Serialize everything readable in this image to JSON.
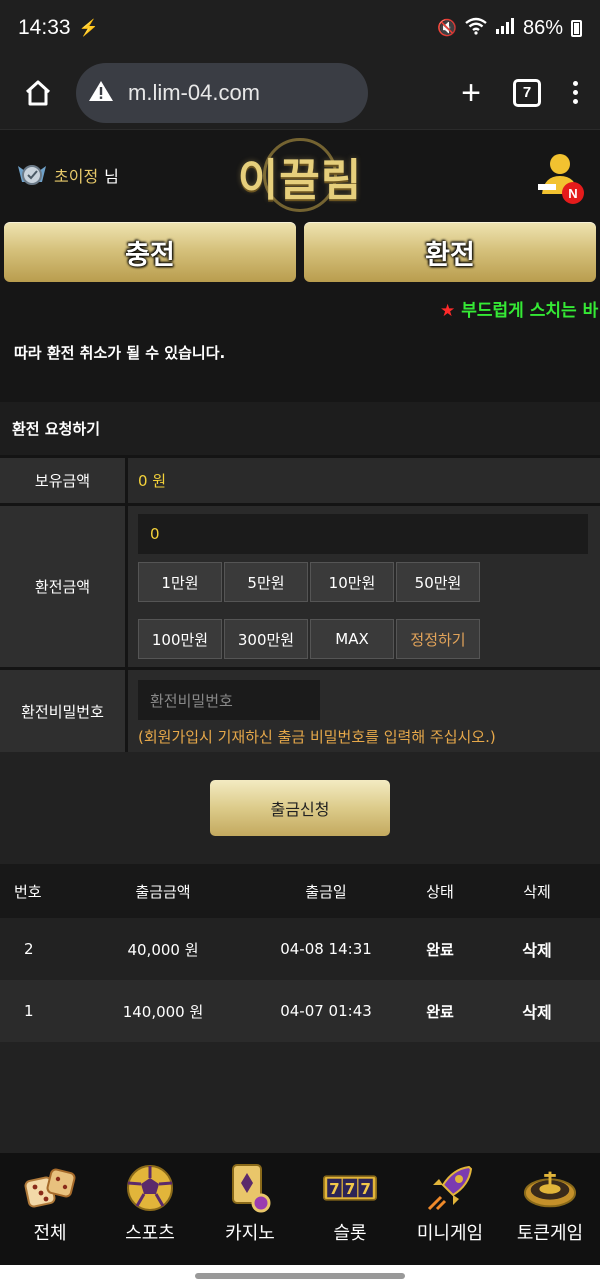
{
  "status_bar": {
    "time": "14:33",
    "battery": "86%"
  },
  "browser": {
    "url": "m.lim-04.com",
    "tab_count": "7"
  },
  "header": {
    "username": "초이정",
    "username_suffix": "님",
    "logo": "이끌림",
    "notification_badge": "N"
  },
  "actions": {
    "deposit": "충전",
    "withdraw": "환전"
  },
  "marquee": {
    "text": "부드럽게 스치는 바"
  },
  "notice": {
    "text": "따라 환전 취소가 될 수 있습니다."
  },
  "form": {
    "title": "환전 요청하기",
    "balance_label": "보유금액",
    "balance_value": "0 원",
    "amount_label": "환전금액",
    "amount_value": "0",
    "chips": [
      "1만원",
      "5만원",
      "10만원",
      "50만원",
      "100만원",
      "300만원",
      "MAX",
      "정정하기"
    ],
    "password_label": "환전비밀번호",
    "password_placeholder": "환전비밀번호",
    "password_help": "(회원가입시 기재하신 출금 비밀번호를 입력해 주십시오.)",
    "submit": "출금신청"
  },
  "table": {
    "headers": [
      "번호",
      "출금금액",
      "출금일",
      "상태",
      "삭제"
    ],
    "rows": [
      {
        "no": "2",
        "amount": "40,000 원",
        "date": "04-08 14:31",
        "status": "완료",
        "delete": "삭제"
      },
      {
        "no": "1",
        "amount": "140,000 원",
        "date": "04-07 01:43",
        "status": "완료",
        "delete": "삭제"
      }
    ]
  },
  "nav": {
    "items": [
      {
        "label": "전체",
        "icon": "dice-icon"
      },
      {
        "label": "스포츠",
        "icon": "soccer-ball-icon"
      },
      {
        "label": "카지노",
        "icon": "cards-icon"
      },
      {
        "label": "슬롯",
        "icon": "slot-777-icon"
      },
      {
        "label": "미니게임",
        "icon": "rocket-icon"
      },
      {
        "label": "토큰게임",
        "icon": "roulette-icon"
      }
    ]
  },
  "colors": {
    "gold": "#e6cf7c",
    "highlight_yellow": "#f4d23a",
    "help_orange": "#e6a84a",
    "marquee_green": "#35e935"
  }
}
